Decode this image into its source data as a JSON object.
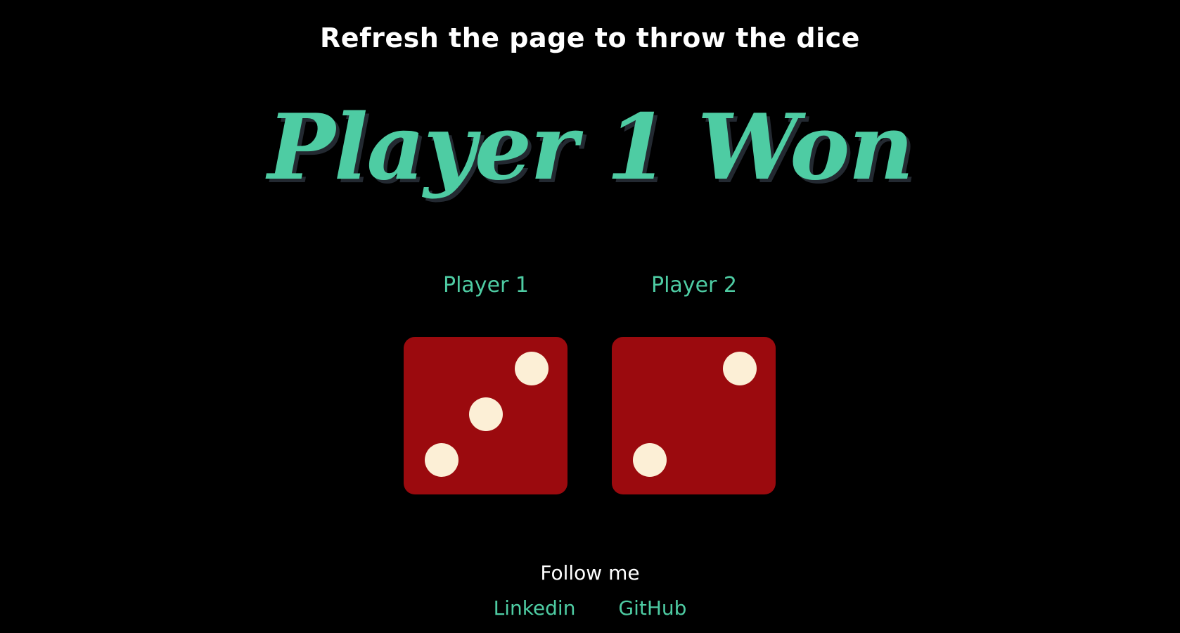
{
  "header": {
    "instruction": "Refresh the page to throw the dice",
    "result": "Player 1 Won"
  },
  "players": [
    {
      "label": "Player 1",
      "die_value": 3
    },
    {
      "label": "Player 2",
      "die_value": 2
    }
  ],
  "footer": {
    "title": "Follow me",
    "links": [
      {
        "label": "Linkedin"
      },
      {
        "label": "GitHub"
      }
    ]
  },
  "colors": {
    "background": "#000000",
    "accent": "#4ecca3",
    "die": "#9b0a0e",
    "pip": "#fcefd6",
    "text": "#ffffff"
  },
  "icons": {
    "die_1": "dice-three-icon",
    "die_2": "dice-two-icon"
  }
}
